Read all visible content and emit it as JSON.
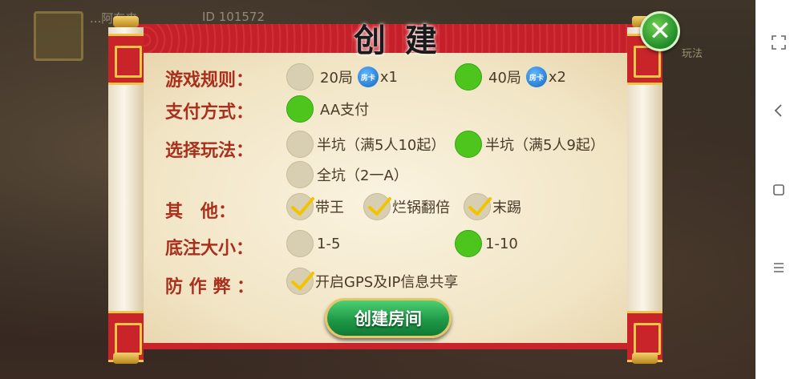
{
  "background": {
    "player_name": "...阿东来",
    "player_id": "ID 101572",
    "side_label": "玩法"
  },
  "dialog": {
    "title": "创建",
    "close_label": "✕",
    "rows": {
      "rules": {
        "label": "游戏规则：",
        "options": [
          {
            "text": "20局",
            "badge": "房卡",
            "mult": "x1",
            "selected": false
          },
          {
            "text": "40局",
            "badge": "房卡",
            "mult": "x2",
            "selected": true
          }
        ]
      },
      "payment": {
        "label": "支付方式：",
        "options": [
          {
            "text": "AA支付",
            "selected": true
          }
        ]
      },
      "mode": {
        "label": "选择玩法：",
        "options": [
          {
            "text": "半坑（满5人10起）",
            "selected": false
          },
          {
            "text": "半坑（满5人9起）",
            "selected": true
          },
          {
            "text": "全坑（2一A）",
            "selected": false
          }
        ]
      },
      "other": {
        "label": "其　他：",
        "options": [
          {
            "text": "带王",
            "checked": true
          },
          {
            "text": "烂锅翻倍",
            "checked": true
          },
          {
            "text": "末踢",
            "checked": true
          }
        ]
      },
      "base_bet": {
        "label": "底注大小：",
        "options": [
          {
            "text": "1-5",
            "selected": false
          },
          {
            "text": "1-10",
            "selected": true
          }
        ]
      },
      "anti_cheat": {
        "label": "防 作 弊 ：",
        "options": [
          {
            "text": "开启GPS及IP信息共享",
            "checked": true
          }
        ]
      }
    },
    "create_button": "创建房间"
  },
  "colors": {
    "selected_green": "#4ec51d",
    "label_red": "#a8301c",
    "check_yellow": "#f2c400"
  }
}
